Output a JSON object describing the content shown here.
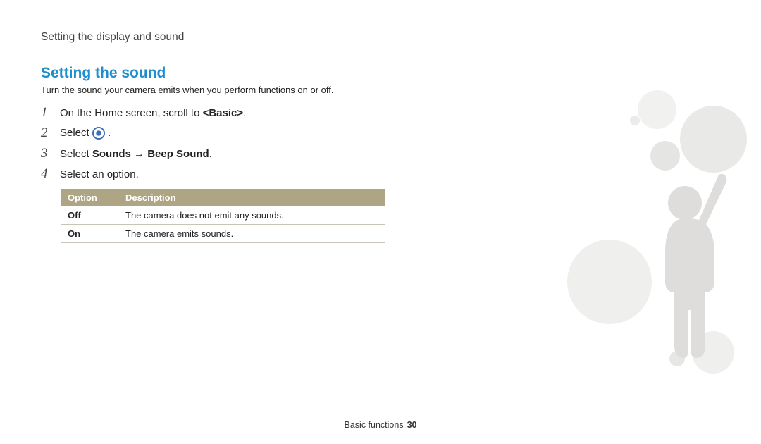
{
  "breadcrumb": "Setting the display and sound",
  "section": {
    "heading": "Setting the sound",
    "description": "Turn the sound your camera emits when you perform functions on or off."
  },
  "steps": [
    {
      "num": "1",
      "prefix": "On the Home screen, scroll to ",
      "bold": "<Basic>",
      "suffix": "."
    },
    {
      "num": "2",
      "prefix": "Select ",
      "icon": "beep-sound-icon",
      "suffix": "."
    },
    {
      "num": "3",
      "prefix": "Select ",
      "bold": "Sounds → Beep Sound",
      "suffix": "."
    },
    {
      "num": "4",
      "prefix": "Select an option."
    }
  ],
  "table": {
    "headers": {
      "col1": "Option",
      "col2": "Description"
    },
    "rows": [
      {
        "option": "Off",
        "desc": "The camera does not emit any sounds."
      },
      {
        "option": "On",
        "desc": "The camera emits sounds."
      }
    ]
  },
  "footer": {
    "section": "Basic functions",
    "page": "30"
  }
}
